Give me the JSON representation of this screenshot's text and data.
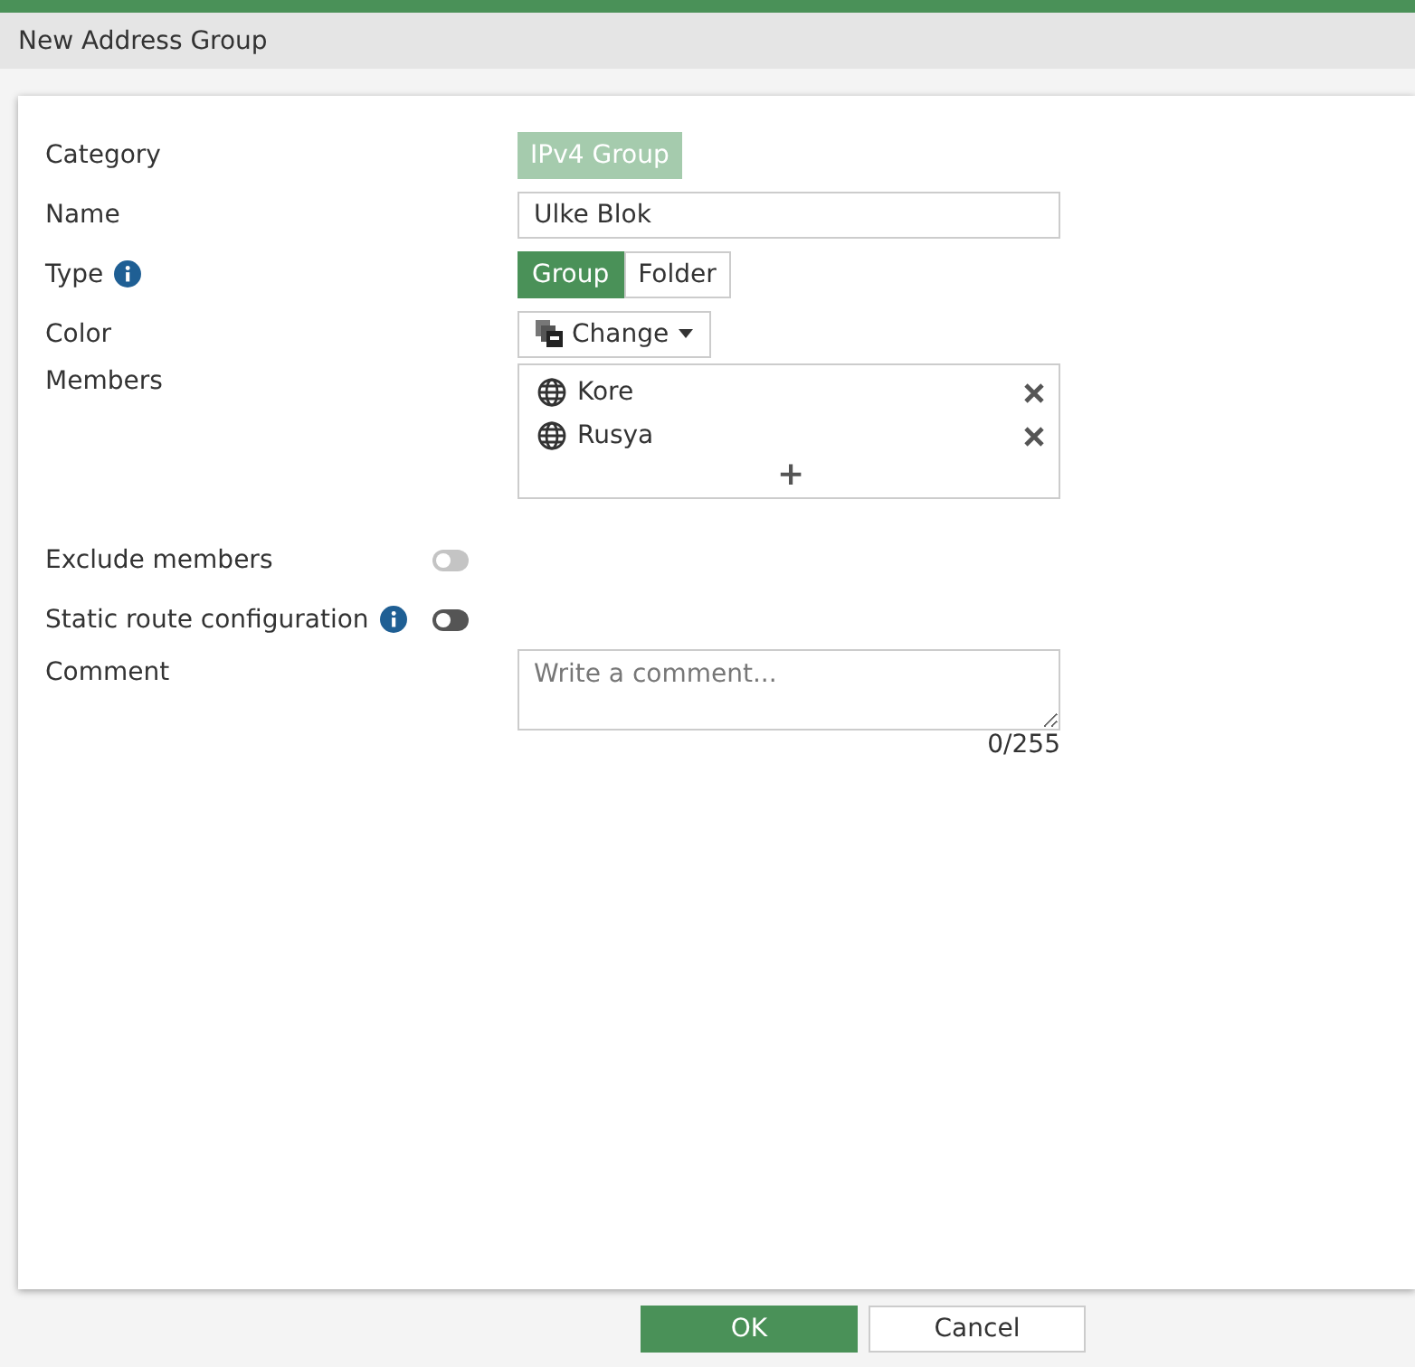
{
  "window": {
    "title": "New Address Group"
  },
  "form": {
    "category": {
      "label": "Category",
      "value": "IPv4 Group"
    },
    "name": {
      "label": "Name",
      "value": "Ulke Blok"
    },
    "type": {
      "label": "Type",
      "info": true,
      "options": [
        {
          "label": "Group",
          "selected": true
        },
        {
          "label": "Folder",
          "selected": false
        }
      ]
    },
    "color": {
      "label": "Color",
      "button": "Change"
    },
    "members": {
      "label": "Members",
      "items": [
        {
          "name": "Kore"
        },
        {
          "name": "Rusya"
        }
      ],
      "add": "+"
    },
    "toggles": [
      {
        "label": "Exclude members",
        "info": false,
        "on": false,
        "disabled": true
      },
      {
        "label": "Static route configuration",
        "info": true,
        "on": false,
        "disabled": false
      }
    ],
    "comment": {
      "label": "Comment",
      "placeholder": "Write a comment...",
      "counter": "0/255"
    }
  },
  "buttons": [
    {
      "label": "OK",
      "kind": "primary"
    },
    {
      "label": "Cancel",
      "kind": "secondary"
    }
  ]
}
